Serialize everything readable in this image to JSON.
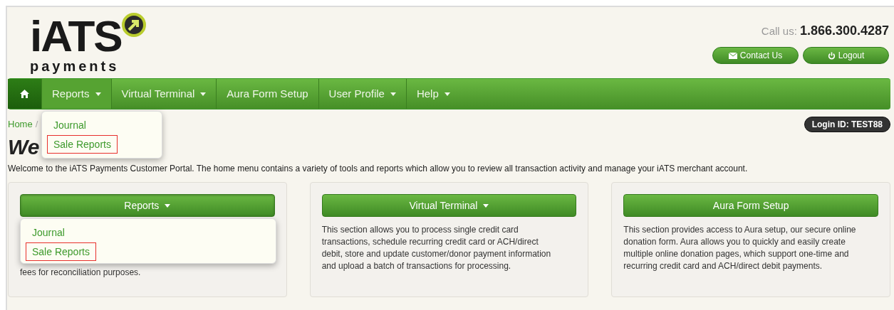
{
  "logo": {
    "wordmark": "iATS",
    "tagline": "payments"
  },
  "header": {
    "call_label": "Call us:",
    "phone": "1.866.300.4287",
    "buttons": [
      {
        "kind": "contact",
        "label": "Contact Us"
      },
      {
        "kind": "logout",
        "label": "Logout"
      }
    ]
  },
  "nav": {
    "items": [
      {
        "label": "Reports",
        "kind": "dropdown",
        "expanded": true
      },
      {
        "label": "Virtual Terminal",
        "kind": "dropdown",
        "expanded": false
      },
      {
        "label": "Aura Form Setup",
        "kind": "link",
        "expanded": false
      },
      {
        "label": "User Profile",
        "kind": "dropdown",
        "expanded": false
      },
      {
        "label": "Help",
        "kind": "dropdown",
        "expanded": false
      }
    ],
    "menu": [
      {
        "label": "Journal",
        "highlighted": false
      },
      {
        "label": "Sale Reports",
        "highlighted": true
      }
    ]
  },
  "breadcrumb": [
    {
      "label": "Home",
      "separator": "/"
    }
  ],
  "login_badge": "Login ID: TEST88",
  "heading": "We",
  "intro": "Welcome to the iATS Payments Customer Portal. The home menu contains a variety of tools and reports which allow you to review all transaction activity and manage your iATS merchant account.",
  "cards": [
    {
      "button": "Reports",
      "kind": "dropdown",
      "expanded": true,
      "text": "fees for reconciliation purposes.",
      "menu": [
        {
          "label": "Journal",
          "highlighted": false
        },
        {
          "label": "Sale Reports",
          "highlighted": true
        }
      ]
    },
    {
      "button": "Virtual Terminal",
      "kind": "dropdown",
      "expanded": false,
      "text": "This section allows you to process single credit card transactions, schedule recurring credit card or ACH/direct debit, store and update customer/donor payment information and upload a batch of transactions for processing."
    },
    {
      "button": "Aura Form Setup",
      "kind": "link",
      "expanded": false,
      "text": "This section provides access to Aura setup, our secure online donation form. Aura allows you to quickly and easily create multiple online donation pages, which support one-time and recurring credit card and ACH/direct debit payments."
    }
  ]
}
